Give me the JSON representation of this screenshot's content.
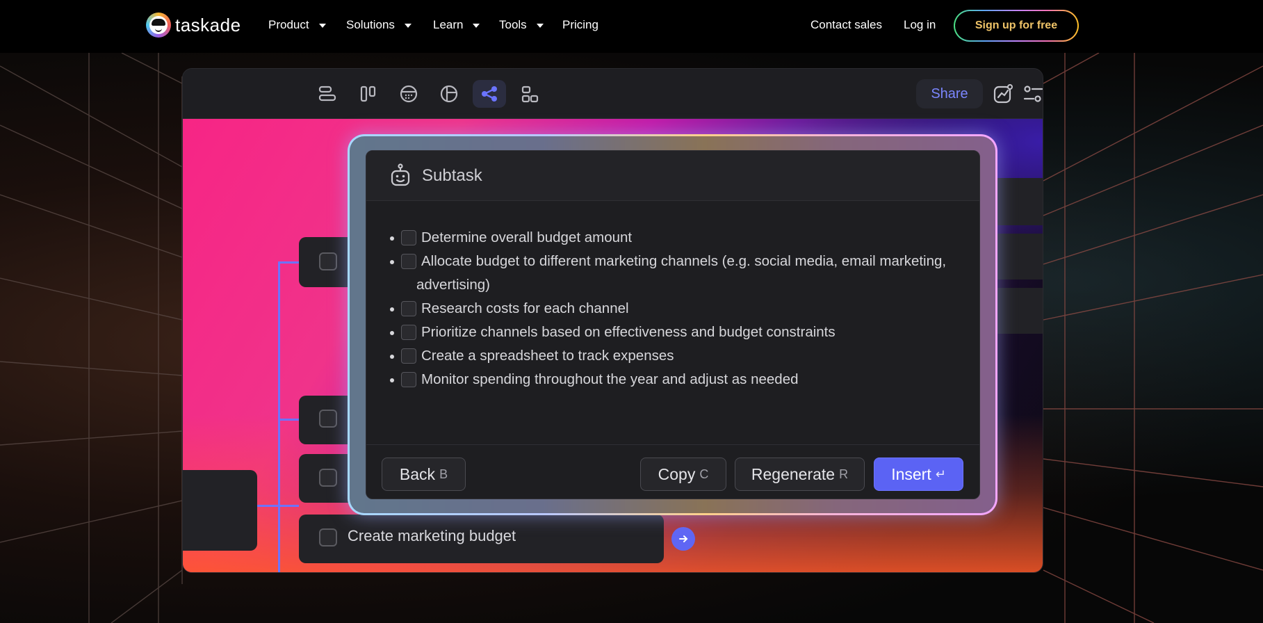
{
  "brand": {
    "name": "taskade"
  },
  "nav": {
    "items": [
      {
        "label": "Product"
      },
      {
        "label": "Solutions"
      },
      {
        "label": "Learn"
      },
      {
        "label": "Tools"
      },
      {
        "label": "Pricing"
      }
    ],
    "contact_sales": "Contact sales",
    "login": "Log in",
    "signup": "Sign up for free"
  },
  "app": {
    "toolbar": {
      "views": [
        "list-view-icon",
        "board-view-icon",
        "calendar-view-icon",
        "table-view-icon",
        "mindmap-view-icon",
        "org-chart-view-icon"
      ],
      "active_view": "mindmap-view-icon",
      "share_label": "Share"
    },
    "canvas": {
      "task_label": "Create marketing budget"
    },
    "modal": {
      "title": "Subtask",
      "items": [
        "Determine overall budget amount",
        "Allocate budget to different marketing channels (e.g. social media, email marketing, advertising)",
        "Research costs for each channel",
        "Prioritize channels based on effectiveness and budget constraints",
        "Create a spreadsheet to track expenses",
        "Monitor spending throughout the year and adjust as needed"
      ],
      "buttons": {
        "back": "Back",
        "back_key": "B",
        "copy": "Copy",
        "copy_key": "C",
        "regenerate": "Regenerate",
        "regenerate_key": "R",
        "insert": "Insert",
        "insert_key": "↵"
      }
    }
  },
  "colors": {
    "accent": "#5b63f4",
    "signup_text": "#f0c468"
  }
}
